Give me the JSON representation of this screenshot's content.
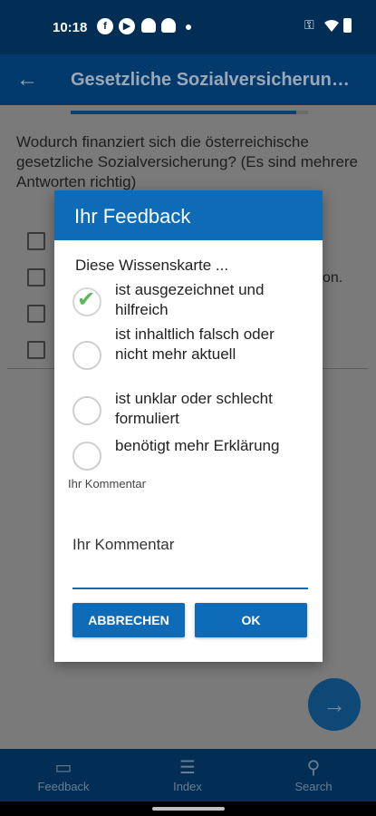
{
  "status_bar": {
    "time": "10:18",
    "icons": [
      "facebook-icon",
      "play-icon",
      "android-icon",
      "android-icon",
      "dot-icon",
      "key-icon",
      "wifi-icon",
      "battery-icon"
    ]
  },
  "app_bar": {
    "title": "Gesetzliche Sozialversicherung…",
    "back_icon": "arrow-left-icon"
  },
  "question": {
    "text": "Wodurch finanziert sich die österreichische gesetzliche Sozialversicherung? (Es sind mehrere Antworten richtig)",
    "progress_fraction": 0.95
  },
  "background_option_tail": "on.",
  "dialog": {
    "title": "Ihr Feedback",
    "subtitle": "Diese Wissenskarte ...",
    "options": [
      {
        "label": "ist ausgezeichnet und hilfreich",
        "checked": true
      },
      {
        "label": "ist inhaltlich falsch oder nicht mehr aktuell",
        "checked": false
      },
      {
        "label": "ist unklar oder schlecht formuliert",
        "checked": false
      },
      {
        "label": "benötigt mehr Erklärung",
        "checked": false
      }
    ],
    "comment_label_small": "Ihr Kommentar",
    "comment_placeholder": "Ihr Kommentar",
    "cancel_label": "ABBRECHEN",
    "ok_label": "OK"
  },
  "bottom_nav": [
    {
      "label": "Feedback",
      "icon": "chat-icon"
    },
    {
      "label": "Index",
      "icon": "list-icon"
    },
    {
      "label": "Search",
      "icon": "search-icon"
    }
  ],
  "colors": {
    "primary": "#0d6bb8",
    "appbar": "#033a6e",
    "status": "#022d55",
    "check": "#5cb85c"
  }
}
